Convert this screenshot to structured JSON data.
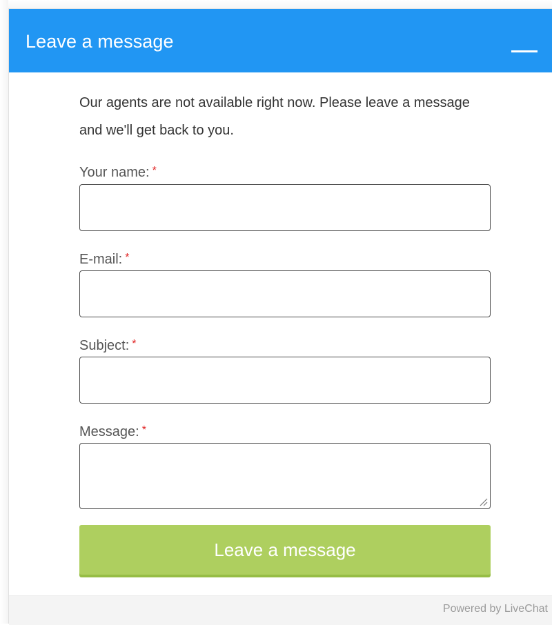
{
  "header": {
    "title": "Leave a message",
    "minimize_icon": "minimize-icon"
  },
  "form": {
    "intro_text": "Our agents are not available right now. Please leave a message and we'll get back to you.",
    "required_marker": "*",
    "fields": [
      {
        "label": "Your name:",
        "value": "",
        "placeholder": ""
      },
      {
        "label": "E-mail:",
        "value": "",
        "placeholder": ""
      },
      {
        "label": "Subject:",
        "value": "",
        "placeholder": ""
      },
      {
        "label": "Message:",
        "value": "",
        "placeholder": ""
      }
    ],
    "submit_label": "Leave a message"
  },
  "footer": {
    "powered_by": "Powered by LiveChat"
  },
  "colors": {
    "header_bg": "#2196f3",
    "submit_bg": "#aecf5f",
    "required": "#e02020",
    "footer_bg": "#f4f4f4"
  }
}
